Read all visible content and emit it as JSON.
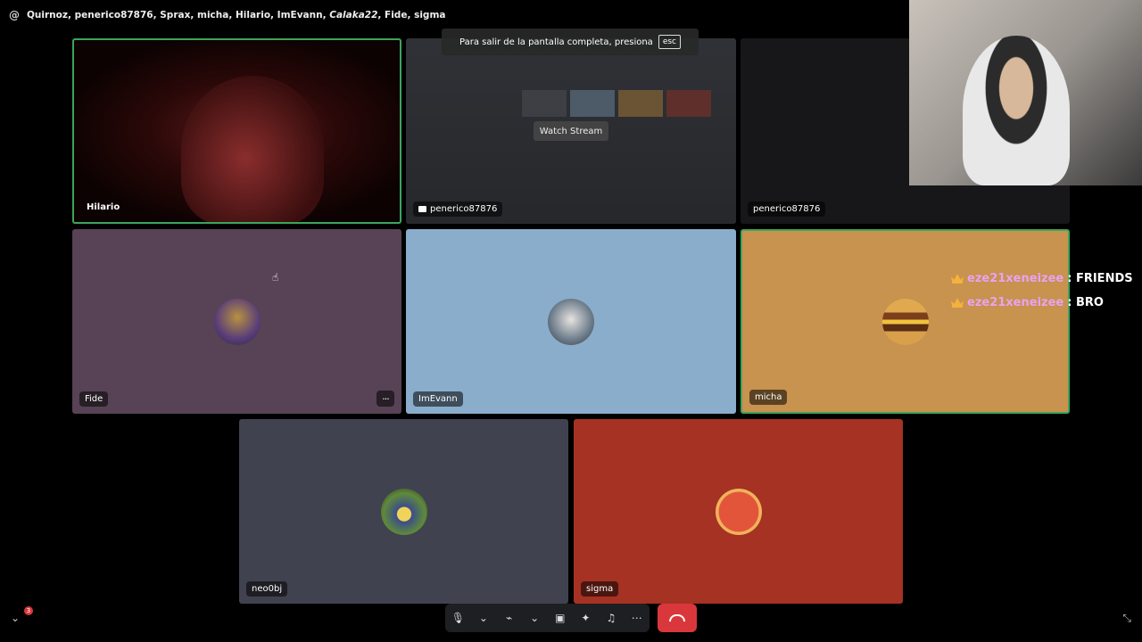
{
  "call": {
    "channel_prefix": "@",
    "participants_text": "Quirnoz, penerico87876, Sprax, micha, Hilario, ImEvann,",
    "participants_italic": "Calaka22",
    "participants_tail": ", Fide, sigma"
  },
  "banner": {
    "text": "Para salir de la pantalla completa, presiona",
    "key": "esc"
  },
  "tiles": {
    "hilario": {
      "name": "Hilario"
    },
    "stream": {
      "name": "penerico87876",
      "watch_label": "Watch Stream"
    },
    "penerico": {
      "name": "penerico87876"
    },
    "fide": {
      "name": "Fide",
      "more": "···"
    },
    "imevann": {
      "name": "ImEvann"
    },
    "micha": {
      "name": "micha"
    },
    "neo": {
      "name": "neo0bj"
    },
    "sigma": {
      "name": "sigma"
    }
  },
  "chat": [
    {
      "user": "eze21xeneizee",
      "message": ": FRIENDS"
    },
    {
      "user": "eze21xeneizee",
      "message": ": BRO"
    }
  ],
  "notifications": {
    "count": "3"
  },
  "colors": {
    "fide_bg": "#574355",
    "imevann_bg": "#8aadcc",
    "micha_bg": "#c8924f",
    "neo_bg": "#40424f",
    "sigma_bg": "#a53222",
    "speaking": "#3ba55c",
    "hangup": "#da373c"
  }
}
